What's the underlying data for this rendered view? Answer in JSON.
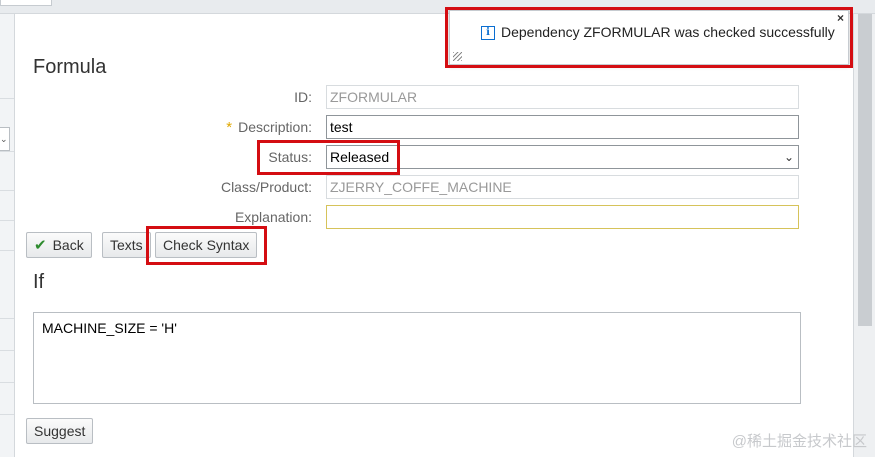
{
  "toast": {
    "message": "Dependency ZFORMULAR was checked successfully",
    "close_glyph": "×",
    "info_glyph": "i"
  },
  "form": {
    "title": "Formula",
    "required_marker": "*",
    "fields": {
      "id": {
        "label": "ID:",
        "value": "ZFORMULAR"
      },
      "description": {
        "label": "Description:",
        "value": "test"
      },
      "status": {
        "label": "Status:",
        "value": "Released"
      },
      "class_product": {
        "label": "Class/Product:",
        "value": "ZJERRY_COFFE_MACHINE"
      },
      "explanation": {
        "label": "Explanation:",
        "value": ""
      }
    }
  },
  "toolbar": {
    "back": "Back",
    "texts": "Texts",
    "check_syntax": "Check Syntax"
  },
  "condition": {
    "title": "If",
    "text": "MACHINE_SIZE = 'H'"
  },
  "footer": {
    "suggest": "Suggest"
  },
  "watermark": "@稀土掘金技术社区",
  "colors": {
    "highlight": "#d40d12",
    "info_blue": "#0a6ed1",
    "required_star": "#e0a800",
    "check_green": "#2e8b2e"
  }
}
